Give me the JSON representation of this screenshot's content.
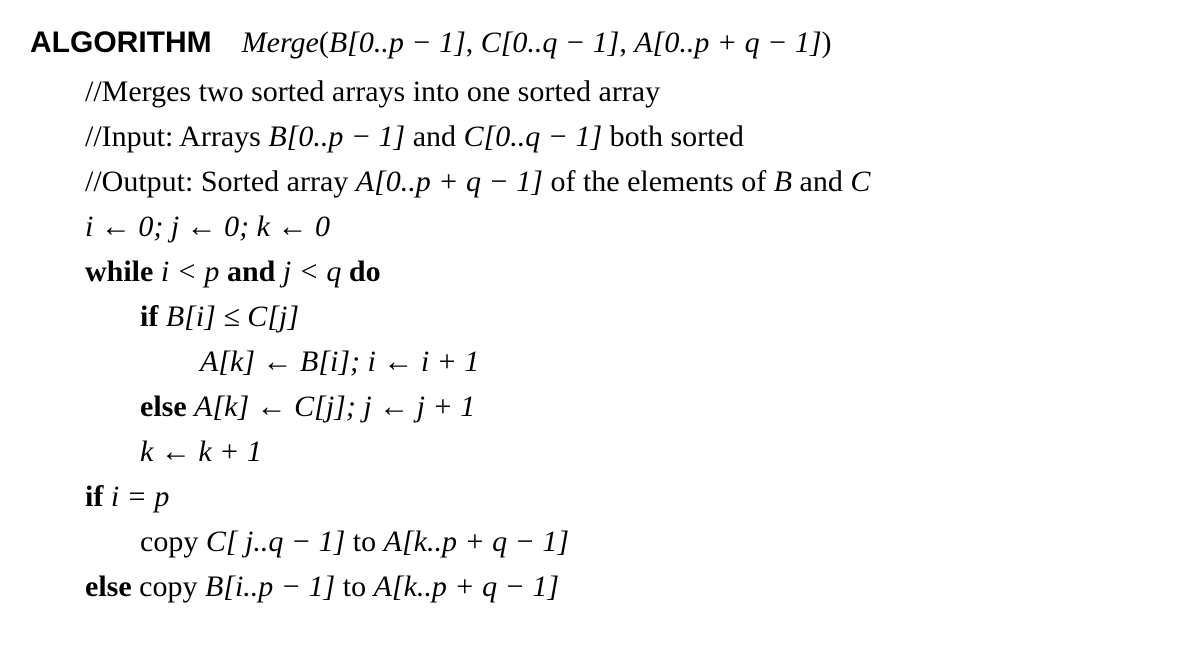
{
  "algo": {
    "label": "ALGORITHM",
    "name": "Merge",
    "sig_B": "B[0..p − 1]",
    "sig_C": "C[0..q − 1]",
    "sig_A": "A[0..p + q − 1]",
    "comment1": "//Merges two sorted arrays into one sorted array",
    "comment2_prefix": "//Input: Arrays ",
    "comment2_B": "B[0..p − 1]",
    "comment2_mid": " and ",
    "comment2_C": "C[0..q − 1]",
    "comment2_suffix": " both sorted",
    "comment3_prefix": "//Output: Sorted array ",
    "comment3_A": "A[0..p + q − 1]",
    "comment3_mid": " of the elements of ",
    "comment3_B": "B",
    "comment3_and": " and ",
    "comment3_C": "C",
    "init": "i ← 0;  j ← 0;  k ← 0",
    "while_kw": "while ",
    "while_cond1": "i < p",
    "and_kw": " and ",
    "while_cond2": "j < q",
    "do_kw": " do",
    "if_kw": "if ",
    "if_cond": "B[i] ≤ C[j]",
    "if_body": "A[k] ← B[i];  i ← i + 1",
    "else_kw": "else ",
    "else_body": "A[k] ← C[j];  j ← j + 1",
    "k_inc": "k ← k + 1",
    "if2_kw": "if ",
    "if2_cond": "i = p",
    "copy1_prefix": "copy ",
    "copy1_C": "C[ j..q − 1]",
    "copy1_mid": " to ",
    "copy1_A": "A[k..p + q − 1]",
    "else2_kw": "else ",
    "copy2_prefix": "copy ",
    "copy2_B": "B[i..p − 1]",
    "copy2_mid": " to ",
    "copy2_A": "A[k..p + q − 1]"
  }
}
